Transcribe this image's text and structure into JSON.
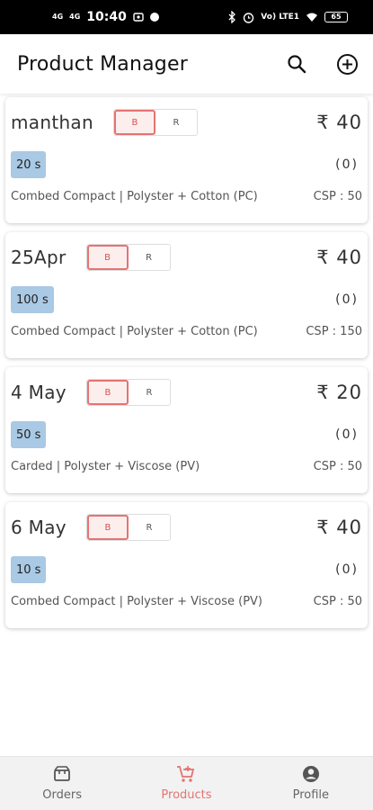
{
  "status_bar": {
    "signal1": "4G",
    "signal2": "4G",
    "time": "10:40",
    "right_text": "Vo) LTE1",
    "battery": "65"
  },
  "app_bar": {
    "title": "Product Manager",
    "search_icon": "search-icon",
    "add_icon": "add-circle-icon"
  },
  "products": [
    {
      "name": "manthan",
      "toggle_b": "B",
      "toggle_r": "R",
      "price": "₹ 40",
      "count": "20 s",
      "qty": "(0)",
      "description": "Combed Compact | Polyster + Cotton (PC)",
      "csp": "CSP : 50"
    },
    {
      "name": "25Apr",
      "toggle_b": "B",
      "toggle_r": "R",
      "price": "₹ 40",
      "count": "100 s",
      "qty": "(0)",
      "description": "Combed Compact | Polyster + Cotton (PC)",
      "csp": "CSP : 150"
    },
    {
      "name": "4 May",
      "toggle_b": "B",
      "toggle_r": "R",
      "price": "₹ 20",
      "count": "50 s",
      "qty": "(0)",
      "description": "Carded | Polyster + Viscose (PV)",
      "csp": "CSP : 50"
    },
    {
      "name": "6 May",
      "toggle_b": "B",
      "toggle_r": "R",
      "price": "₹ 40",
      "count": "10 s",
      "qty": "(0)",
      "description": "Combed Compact | Polyster + Viscose (PV)",
      "csp": "CSP : 50"
    }
  ],
  "bottom_nav": {
    "orders": "Orders",
    "products": "Products",
    "profile": "Profile",
    "active": "products"
  },
  "colors": {
    "accent": "#e57373",
    "badge": "#a9c9e4"
  }
}
